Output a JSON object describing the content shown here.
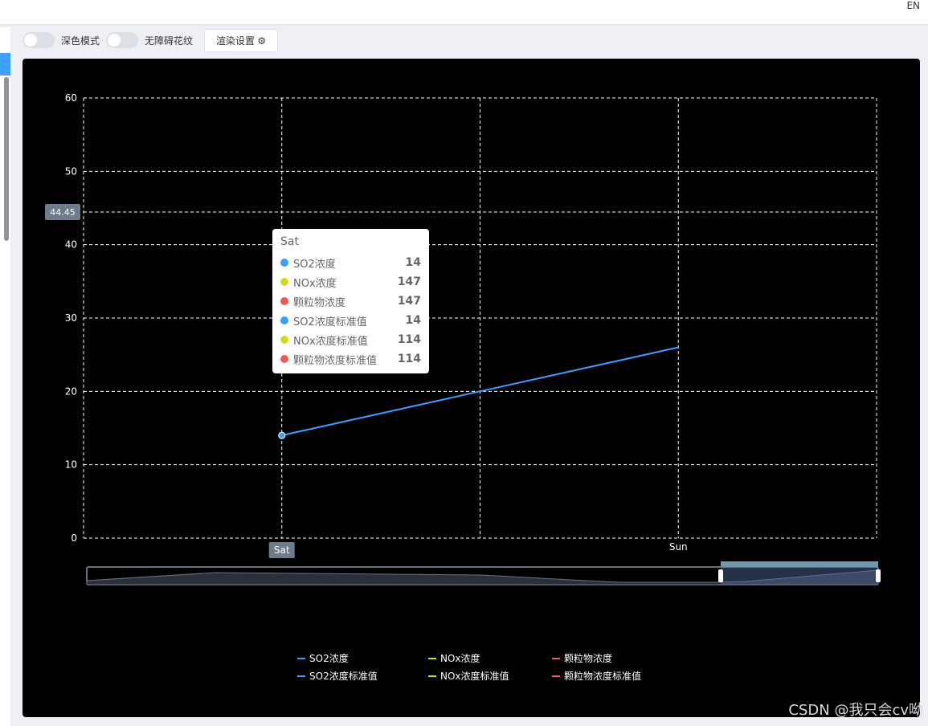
{
  "header": {
    "lang": "EN"
  },
  "toolbar": {
    "dark_mode_label": "深色模式",
    "accessibility_label": "无障碍花纹",
    "render_settings_label": "渲染设置 ⚙"
  },
  "chart_data": {
    "type": "line",
    "categories": [
      "Sat",
      "",
      "Sun",
      ""
    ],
    "ylim": [
      0,
      60
    ],
    "yticks": [
      "0",
      "10",
      "20",
      "30",
      "40",
      "50",
      "60"
    ],
    "xtick_labels": [
      "Sat",
      "Sun"
    ],
    "grid": true,
    "series": [
      {
        "name": "SO2浓度",
        "color": "#3aa0ff",
        "values": [
          14,
          20,
          26
        ]
      }
    ],
    "axis_pointer_label": "44.45",
    "legend_position": "bottom",
    "legend": [
      {
        "name": "SO2浓度",
        "color": "#3aa0ff"
      },
      {
        "name": "NOx浓度",
        "color": "#d6dc1a"
      },
      {
        "name": "颗粒物浓度",
        "color": "#ee5a5a"
      },
      {
        "name": "SO2浓度标准值",
        "color": "#3aa0ff"
      },
      {
        "name": "NOx浓度标准值",
        "color": "#d6dc1a"
      },
      {
        "name": "颗粒物浓度标准值",
        "color": "#ee5a5a"
      }
    ],
    "tooltip": {
      "title": "Sat",
      "rows": [
        {
          "name": "SO2浓度",
          "value": "14",
          "color": "#3aa0ff"
        },
        {
          "name": "NOx浓度",
          "value": "147",
          "color": "#d6dc1a"
        },
        {
          "name": "颗粒物浓度",
          "value": "147",
          "color": "#ee5a5a"
        },
        {
          "name": "SO2浓度标准值",
          "value": "14",
          "color": "#3aa0ff"
        },
        {
          "name": "NOx浓度标准值",
          "value": "114",
          "color": "#d6dc1a"
        },
        {
          "name": "颗粒物浓度标准值",
          "value": "114",
          "color": "#ee5a5a"
        }
      ]
    }
  },
  "watermark": "CSDN @我只会cv呦"
}
